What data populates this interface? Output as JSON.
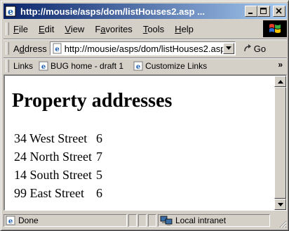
{
  "window": {
    "title": "http://mousie/asps/dom/listHouses2.asp ...",
    "title_bar_color": "#0a246a"
  },
  "menu": {
    "items": [
      {
        "pre": "",
        "key": "F",
        "post": "ile"
      },
      {
        "pre": "",
        "key": "E",
        "post": "dit"
      },
      {
        "pre": "",
        "key": "V",
        "post": "iew"
      },
      {
        "pre": "F",
        "key": "a",
        "post": "vorites"
      },
      {
        "pre": "",
        "key": "T",
        "post": "ools"
      },
      {
        "pre": "",
        "key": "H",
        "post": "elp"
      }
    ]
  },
  "address": {
    "label_pre": "A",
    "label_key": "d",
    "label_post": "dress",
    "value": "http://mousie/asps/dom/listHouses2.asp",
    "go_label": "Go"
  },
  "links": {
    "label": "Links",
    "items": [
      "BUG home - draft 1",
      "Customize Links"
    ],
    "more": "»"
  },
  "page": {
    "heading": "Property addresses",
    "rows": [
      {
        "address": "34 West Street",
        "count": "6"
      },
      {
        "address": "24 North Street",
        "count": "7"
      },
      {
        "address": "14 South Street",
        "count": "5"
      },
      {
        "address": "99 East Street",
        "count": "6"
      }
    ]
  },
  "status": {
    "text": "Done",
    "zone": "Local intranet"
  }
}
